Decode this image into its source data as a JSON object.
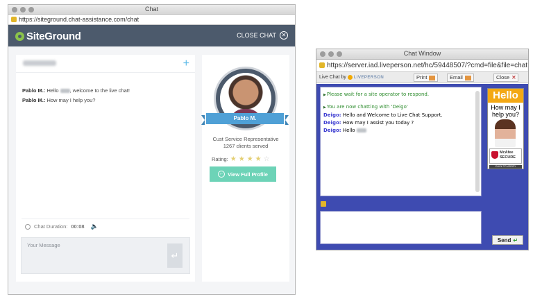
{
  "window1": {
    "title": "Chat",
    "url": "https://siteground.chat-assistance.com/chat",
    "logo": "SiteGround",
    "close_chat": "CLOSE CHAT",
    "messages": [
      {
        "sender": "Pablo M.:",
        "before": "Hello",
        "after": ", welcome to the live chat!"
      },
      {
        "sender": "Pablo M.:",
        "text": "How may I help you?"
      }
    ],
    "duration_label": "Chat Duration:",
    "duration_value": "00:08",
    "message_placeholder": "Your Message",
    "agent": {
      "name": "Pablo M.",
      "role": "Cust Service Representative",
      "clients": "1267 clients served",
      "rating_label": "Rating:",
      "rating": 4,
      "rating_max": 5,
      "profile_button": "View Full Profile"
    },
    "colors": {
      "header": "#4c5a6c",
      "accent_blue": "#4fa0d6",
      "accent_green": "#6dd3b7"
    }
  },
  "window2": {
    "title": "Chat Window",
    "url": "https://server.iad.liveperson.net/hc/59448507/?cmd=file&file=chat...",
    "live_chat_by": "Live Chat by",
    "brand": "LIVEPERSON",
    "print": "Print",
    "email": "Email",
    "close": "Close",
    "system_messages": [
      "Please wait for a site operator to respond.",
      "You are now chatting with 'Deigo'"
    ],
    "chat": [
      {
        "sender": "Deigo:",
        "text": "Hello and Welcome to Live Chat Support."
      },
      {
        "sender": "Deigo:",
        "text": "How may I assist you today ?"
      },
      {
        "sender": "Deigo:",
        "text": "Hello"
      }
    ],
    "ad": {
      "hello": "Hello",
      "subtitle": "How may I help you?",
      "mcafee": "McAfee",
      "secure": "SECURE",
      "verify": "CLICK TO VERIFY"
    },
    "send": "Send",
    "colors": {
      "body": "#3e4bb1",
      "ad_orange": "#f3a814"
    }
  }
}
